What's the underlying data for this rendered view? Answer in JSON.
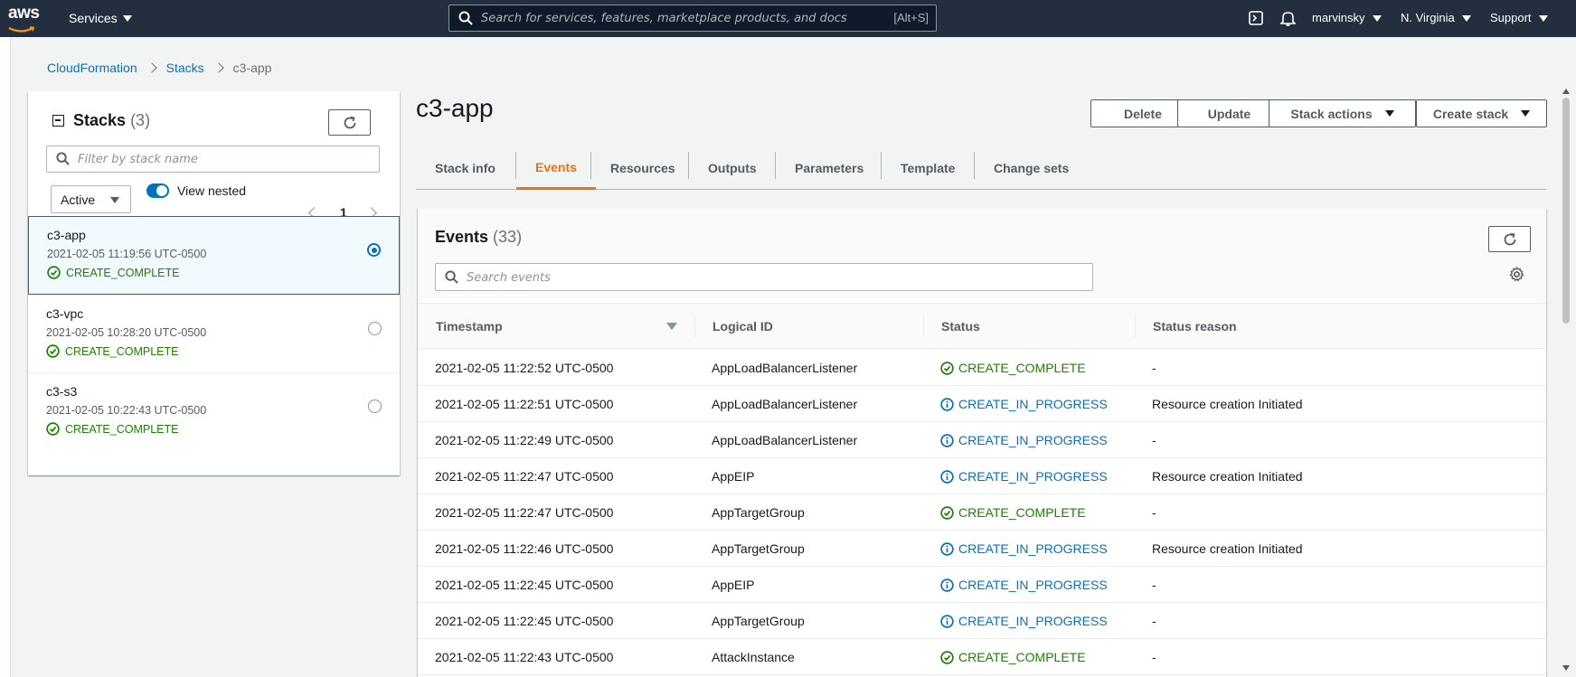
{
  "topnav": {
    "logo_text": "aws",
    "services_label": "Services",
    "search_placeholder": "Search for services, features, marketplace products, and docs",
    "search_shortcut": "[Alt+S]",
    "user_label": "marvinsky",
    "region_label": "N. Virginia",
    "support_label": "Support"
  },
  "breadcrumb": {
    "items": [
      "CloudFormation",
      "Stacks"
    ],
    "current": "c3-app"
  },
  "stacks_panel": {
    "title": "Stacks",
    "count": "(3)",
    "filter_placeholder": "Filter by stack name",
    "status_filter": "Active",
    "view_nested_label": "View nested",
    "view_nested_on": true,
    "page": "1",
    "stacks": [
      {
        "name": "c3-app",
        "time": "2021-02-05 11:19:56 UTC-0500",
        "status": "CREATE_COMPLETE",
        "selected": true
      },
      {
        "name": "c3-vpc",
        "time": "2021-02-05 10:28:20 UTC-0500",
        "status": "CREATE_COMPLETE",
        "selected": false
      },
      {
        "name": "c3-s3",
        "time": "2021-02-05 10:22:43 UTC-0500",
        "status": "CREATE_COMPLETE",
        "selected": false
      }
    ]
  },
  "main": {
    "title": "c3-app",
    "buttons": {
      "delete": "Delete",
      "update": "Update",
      "stack_actions": "Stack actions",
      "create_stack": "Create stack"
    },
    "tabs": [
      "Stack info",
      "Events",
      "Resources",
      "Outputs",
      "Parameters",
      "Template",
      "Change sets"
    ],
    "active_tab": "Events"
  },
  "events": {
    "title": "Events",
    "count": "(33)",
    "search_placeholder": "Search events",
    "columns": [
      "Timestamp",
      "Logical ID",
      "Status",
      "Status reason"
    ],
    "rows": [
      {
        "timestamp": "2021-02-05 11:22:52 UTC-0500",
        "logical_id": "AppLoadBalancerListener",
        "status": "CREATE_COMPLETE",
        "status_kind": "complete",
        "reason": "-"
      },
      {
        "timestamp": "2021-02-05 11:22:51 UTC-0500",
        "logical_id": "AppLoadBalancerListener",
        "status": "CREATE_IN_PROGRESS",
        "status_kind": "progress",
        "reason": "Resource creation Initiated"
      },
      {
        "timestamp": "2021-02-05 11:22:49 UTC-0500",
        "logical_id": "AppLoadBalancerListener",
        "status": "CREATE_IN_PROGRESS",
        "status_kind": "progress",
        "reason": "-"
      },
      {
        "timestamp": "2021-02-05 11:22:47 UTC-0500",
        "logical_id": "AppEIP",
        "status": "CREATE_IN_PROGRESS",
        "status_kind": "progress",
        "reason": "Resource creation Initiated"
      },
      {
        "timestamp": "2021-02-05 11:22:47 UTC-0500",
        "logical_id": "AppTargetGroup",
        "status": "CREATE_COMPLETE",
        "status_kind": "complete",
        "reason": "-"
      },
      {
        "timestamp": "2021-02-05 11:22:46 UTC-0500",
        "logical_id": "AppTargetGroup",
        "status": "CREATE_IN_PROGRESS",
        "status_kind": "progress",
        "reason": "Resource creation Initiated"
      },
      {
        "timestamp": "2021-02-05 11:22:45 UTC-0500",
        "logical_id": "AppEIP",
        "status": "CREATE_IN_PROGRESS",
        "status_kind": "progress",
        "reason": "-"
      },
      {
        "timestamp": "2021-02-05 11:22:45 UTC-0500",
        "logical_id": "AppTargetGroup",
        "status": "CREATE_IN_PROGRESS",
        "status_kind": "progress",
        "reason": "-"
      },
      {
        "timestamp": "2021-02-05 11:22:43 UTC-0500",
        "logical_id": "AttackInstance",
        "status": "CREATE_COMPLETE",
        "status_kind": "complete",
        "reason": "-"
      }
    ]
  },
  "colors": {
    "nav_bg": "#232f3e",
    "link": "#0073bb",
    "accent_tab": "#ec7211",
    "success": "#1d8102",
    "info": "#0073bb"
  }
}
